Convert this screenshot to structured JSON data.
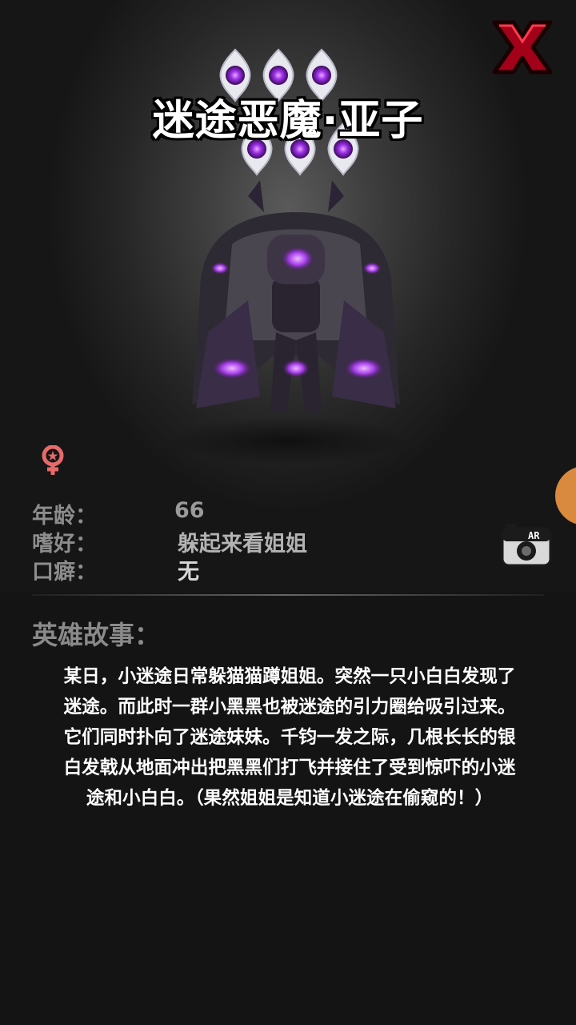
{
  "hero": {
    "name": "迷途恶魔·亚子",
    "star_count": 6,
    "gender_icon": "female-icon",
    "close_icon": "close-x-icon",
    "accent_color": "#a63bff"
  },
  "info": {
    "age_label": "年龄：",
    "age_value": "66",
    "hobby_label": "嗜好：",
    "hobby_value": "躲起来看姐姐",
    "catchphrase_label": "口癖：",
    "catchphrase_value": "无"
  },
  "ar_button": {
    "label": "AR",
    "icon": "camera-icon"
  },
  "story": {
    "title": "英雄故事：",
    "text": "某日，小迷途日常躲猫猫蹲姐姐。突然一只小白白发现了\n迷途。而此时一群小黑黑也被迷途的引力圈给吸引过来。\n它们同时扑向了迷途妹妹。千钧一发之际，几根长长的银\n白发戟从地面冲出把黑黑们打飞并接住了受到惊吓的小迷\n途和小白白。（果然姐姐是知道小迷途在偷窥的！）"
  }
}
